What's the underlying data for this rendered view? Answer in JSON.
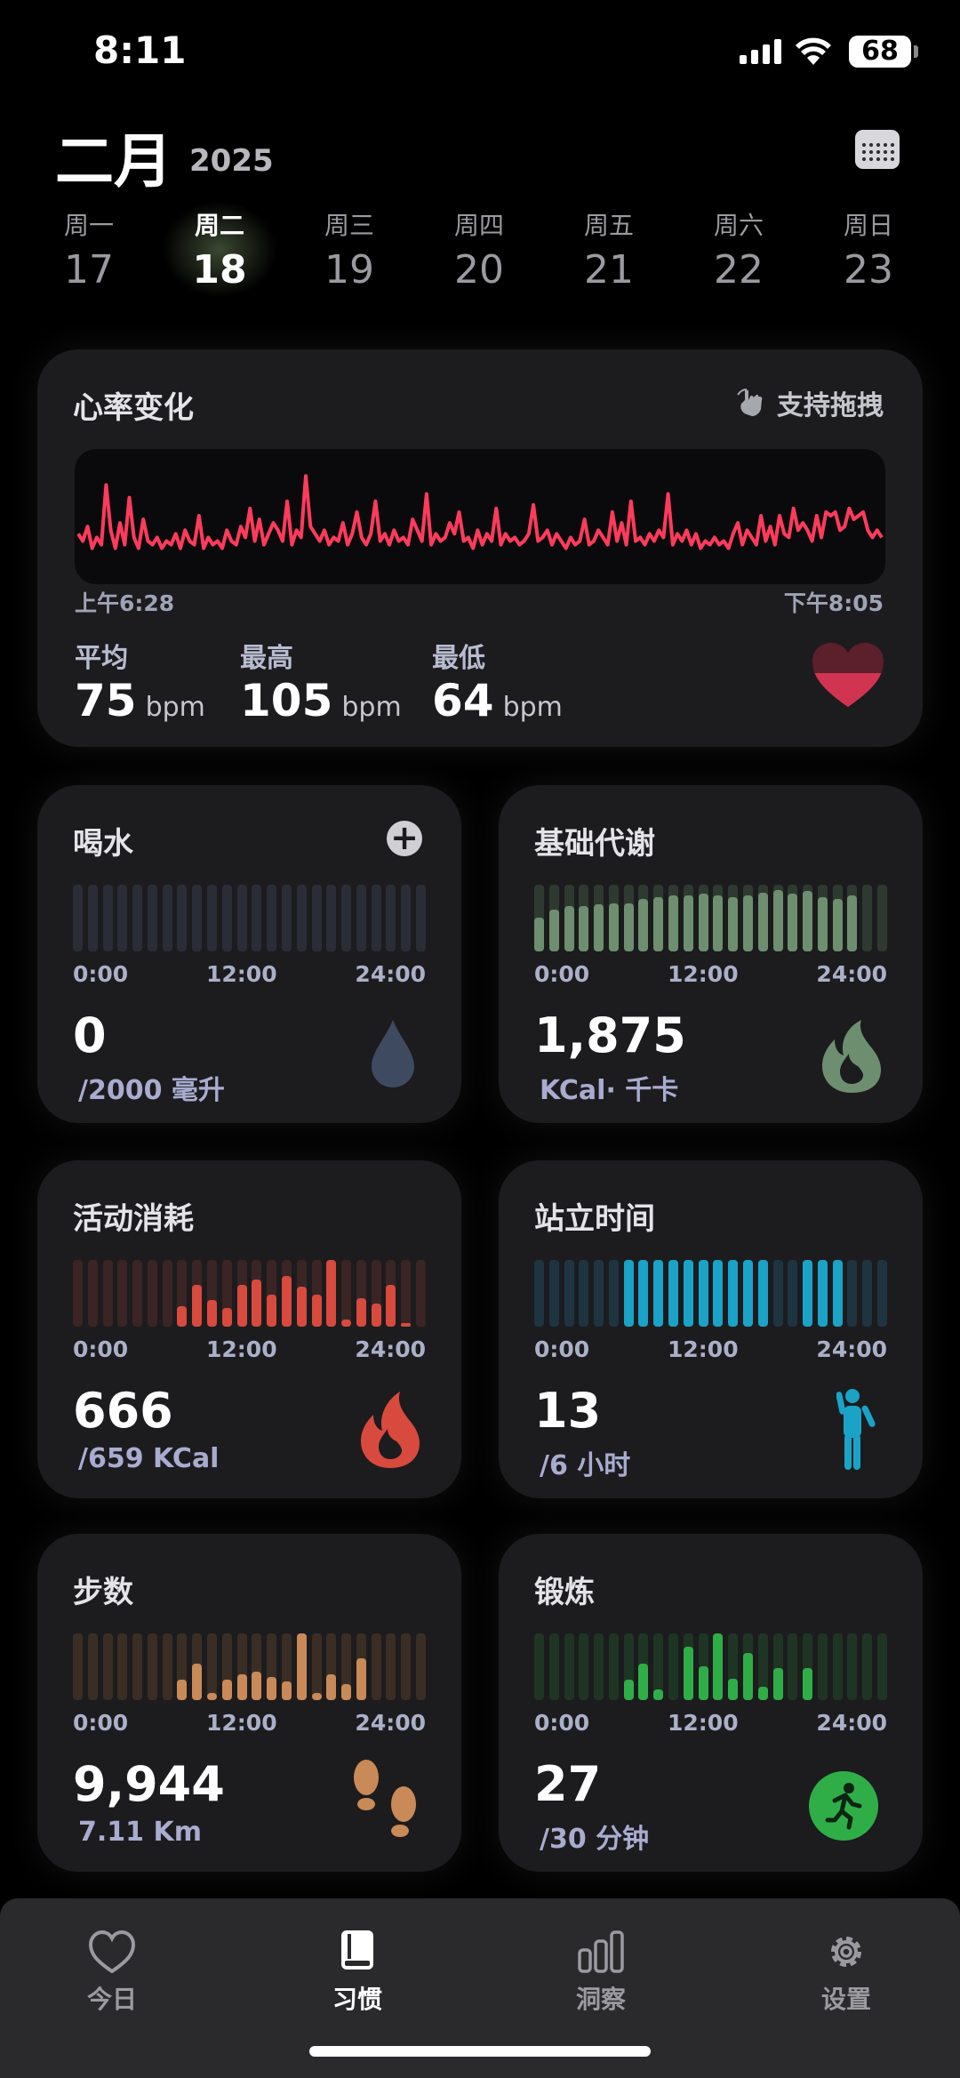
{
  "status": {
    "time": "8:11",
    "battery": "68"
  },
  "header": {
    "month": "二月",
    "year": "2025"
  },
  "week": [
    {
      "name": "周一",
      "date": "17",
      "selected": false
    },
    {
      "name": "周二",
      "date": "18",
      "selected": true
    },
    {
      "name": "周三",
      "date": "19",
      "selected": false
    },
    {
      "name": "周四",
      "date": "20",
      "selected": false
    },
    {
      "name": "周五",
      "date": "21",
      "selected": false
    },
    {
      "name": "周六",
      "date": "22",
      "selected": false
    },
    {
      "name": "周日",
      "date": "23",
      "selected": false
    }
  ],
  "heart": {
    "title": "心率变化",
    "drag_hint": "支持拖拽",
    "start_time": "上午6:28",
    "end_time": "下午8:05",
    "avg_label": "平均",
    "avg": "75",
    "max_label": "最高",
    "max": "105",
    "min_label": "最低",
    "min": "64",
    "unit": "bpm",
    "color": "#ff3b5c",
    "samples": [
      78,
      74,
      82,
      70,
      76,
      72,
      105,
      80,
      70,
      84,
      72,
      98,
      76,
      70,
      86,
      74,
      72,
      76,
      70,
      74,
      72,
      78,
      70,
      80,
      74,
      72,
      88,
      70,
      76,
      72,
      74,
      70,
      80,
      74,
      72,
      82,
      76,
      92,
      74,
      86,
      72,
      78,
      84,
      80,
      74,
      96,
      72,
      80,
      76,
      110,
      82,
      78,
      74,
      80,
      72,
      76,
      74,
      84,
      72,
      78,
      90,
      76,
      72,
      78,
      96,
      74,
      78,
      72,
      80,
      74,
      76,
      72,
      86,
      80,
      74,
      100,
      72,
      78,
      74,
      76,
      84,
      78,
      90,
      74,
      76,
      70,
      80,
      72,
      78,
      74,
      92,
      72,
      78,
      74,
      76,
      72,
      74,
      78,
      94,
      74,
      76,
      80,
      72,
      78,
      74,
      70,
      76,
      72,
      74,
      86,
      72,
      74,
      80,
      76,
      72,
      90,
      74,
      84,
      72,
      96,
      74,
      76,
      72,
      78,
      74,
      80,
      76,
      100,
      72,
      78,
      74,
      80,
      72,
      78,
      70,
      74,
      72,
      76,
      72,
      74,
      70,
      78,
      84,
      72,
      80,
      76,
      72,
      88,
      74,
      82,
      72,
      88,
      78,
      76,
      92,
      80,
      84,
      80,
      74,
      88,
      76,
      90,
      88,
      90,
      80,
      82,
      92,
      86,
      88,
      90,
      80,
      76,
      80,
      76
    ],
    "sample_min": 60,
    "sample_max": 115
  },
  "ticks": [
    "0:00",
    "12:00",
    "24:00"
  ],
  "water": {
    "title": "喝水",
    "value": "0",
    "sub": "/2000 毫升",
    "color": "#3b4355",
    "track": "#2a2d36",
    "bars": [
      0,
      0,
      0,
      0,
      0,
      0,
      0,
      0,
      0,
      0,
      0,
      0,
      0,
      0,
      0,
      0,
      0,
      0,
      0,
      0,
      0,
      0,
      0,
      0
    ]
  },
  "bmr": {
    "title": "基础代谢",
    "value": "1,875",
    "sub": "KCal· 千卡",
    "color": "#6e8f6f",
    "track": "#2e3a30",
    "bars": [
      0.5,
      0.62,
      0.68,
      0.68,
      0.7,
      0.72,
      0.72,
      0.78,
      0.82,
      0.84,
      0.84,
      0.86,
      0.84,
      0.82,
      0.84,
      0.88,
      0.92,
      0.86,
      0.9,
      0.82,
      0.78,
      0.84,
      0,
      0
    ]
  },
  "active": {
    "title": "活动消耗",
    "value": "666",
    "sub": "/659 KCal",
    "color": "#d84a3e",
    "track": "#3a2424",
    "bars": [
      0,
      0,
      0,
      0,
      0,
      0,
      0,
      0.3,
      0.62,
      0.4,
      0.28,
      0.62,
      0.7,
      0.48,
      0.76,
      0.6,
      0.48,
      1.0,
      0.1,
      0.42,
      0.34,
      0.62,
      0.05,
      0
    ]
  },
  "stand": {
    "title": "站立时间",
    "value": "13",
    "sub": "/6 小时",
    "color": "#1aa3c7",
    "track": "#1e3440",
    "bars": [
      0,
      0,
      0,
      0,
      0,
      0,
      1,
      1,
      1,
      1,
      1,
      1,
      1,
      1,
      1,
      1,
      0,
      0,
      1,
      1,
      1,
      0,
      0,
      0
    ]
  },
  "steps": {
    "title": "步数",
    "value": "9,944",
    "sub": "7.11 Km",
    "color": "#c98a58",
    "track": "#3a2e24",
    "bars": [
      0,
      0,
      0,
      0,
      0,
      0,
      0,
      0.3,
      0.55,
      0.1,
      0.3,
      0.38,
      0.42,
      0.34,
      0.28,
      1.0,
      0.1,
      0.38,
      0.24,
      0.62,
      0,
      0,
      0,
      0
    ]
  },
  "workout": {
    "title": "锻炼",
    "value": "27",
    "sub": "/30 分钟",
    "color": "#2fae48",
    "track": "#1e3524",
    "bars": [
      0,
      0,
      0,
      0,
      0,
      0,
      0.3,
      0.54,
      0.16,
      0,
      0.8,
      0.5,
      1.0,
      0.32,
      0.7,
      0.2,
      0.48,
      0,
      0.48,
      0,
      0,
      0,
      0,
      0
    ]
  },
  "tabs": [
    {
      "label": "今日",
      "icon": "heart-icon",
      "active": false
    },
    {
      "label": "习惯",
      "icon": "book-icon",
      "active": true
    },
    {
      "label": "洞察",
      "icon": "bars-icon",
      "active": false
    },
    {
      "label": "设置",
      "icon": "gear-icon",
      "active": false
    }
  ]
}
